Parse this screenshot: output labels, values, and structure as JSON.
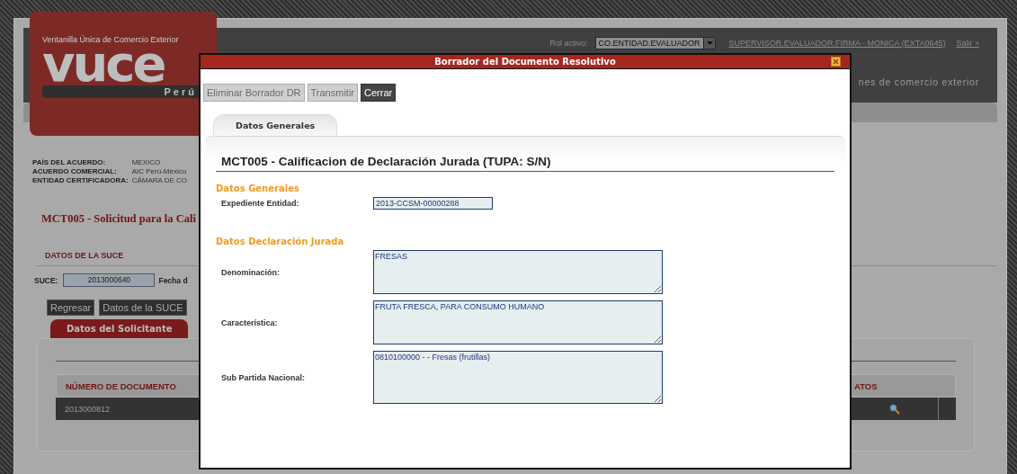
{
  "header": {
    "role_label": "Rol activo:",
    "role_value": "CO.ENTIDAD.EVALUADOR",
    "user_link": "SUPERVISOR.EVALUADOR.FIRMA - MONICA (EXTA0645)",
    "logout_link": "Salir »",
    "tagline": "nes de comercio exterior"
  },
  "logo": {
    "caption": "Ventanilla Única de Comercio Exterior",
    "wordmark": "vuce",
    "country": "Perú"
  },
  "agreement_info": [
    {
      "label": "PAÍS DEL ACUERDO:",
      "value": "MEXICO"
    },
    {
      "label": "ACUERDO COMERCIAL:",
      "value": "AIC Perú-México"
    },
    {
      "label": "ENTIDAD CERTIFICADORA:",
      "value": "CÁMARA DE CO"
    }
  ],
  "page_title": "MCT005 - Solicitud para la Cali",
  "suce_section": {
    "title": "DATOS DE LA SUCE",
    "suce_label": "SUCE:",
    "suce_value": "2013000640",
    "date_label": "Fecha d"
  },
  "page_buttons": [
    "Regresar",
    "Datos de la SUCE"
  ],
  "page_tabs": [
    {
      "label": "Datos del Solicitante",
      "selected": true
    }
  ],
  "documents_table": {
    "columns": [
      "NÚMERO DE DOCUMENTO",
      "ATOS"
    ],
    "rows": [
      {
        "cells": [
          "2013000812"
        ]
      }
    ]
  },
  "dialog": {
    "title": "Borrador del Documento Resolutivo",
    "buttons": [
      {
        "label": "Eliminar Borrador DR",
        "disabled": true
      },
      {
        "label": "Transmitir",
        "disabled": true
      },
      {
        "label": "Cerrar",
        "disabled": false
      }
    ],
    "tabs": [
      {
        "label": "Datos Generales",
        "selected": true
      }
    ],
    "heading": "MCT005 - Calificacion de Declaración Jurada (TUPA: S/N)",
    "sections": [
      {
        "title": "Datos Generales",
        "fields": [
          {
            "kind": "input",
            "label": "Expediente Entidad:",
            "value": "2013-CCSM-00000288"
          }
        ]
      },
      {
        "title": "Datos Declaración Jurada",
        "fields": [
          {
            "kind": "textarea",
            "label": "Denominación:",
            "value": "FRESAS"
          },
          {
            "kind": "textarea",
            "label": "Característica:",
            "value": "FRUTA FRESCA, PARA CONSUMO HUMANO"
          },
          {
            "kind": "textarea",
            "label": "Sub Partida Nacional:",
            "value": "0810100000 - - Fresas (frutillas)"
          }
        ]
      }
    ]
  }
}
